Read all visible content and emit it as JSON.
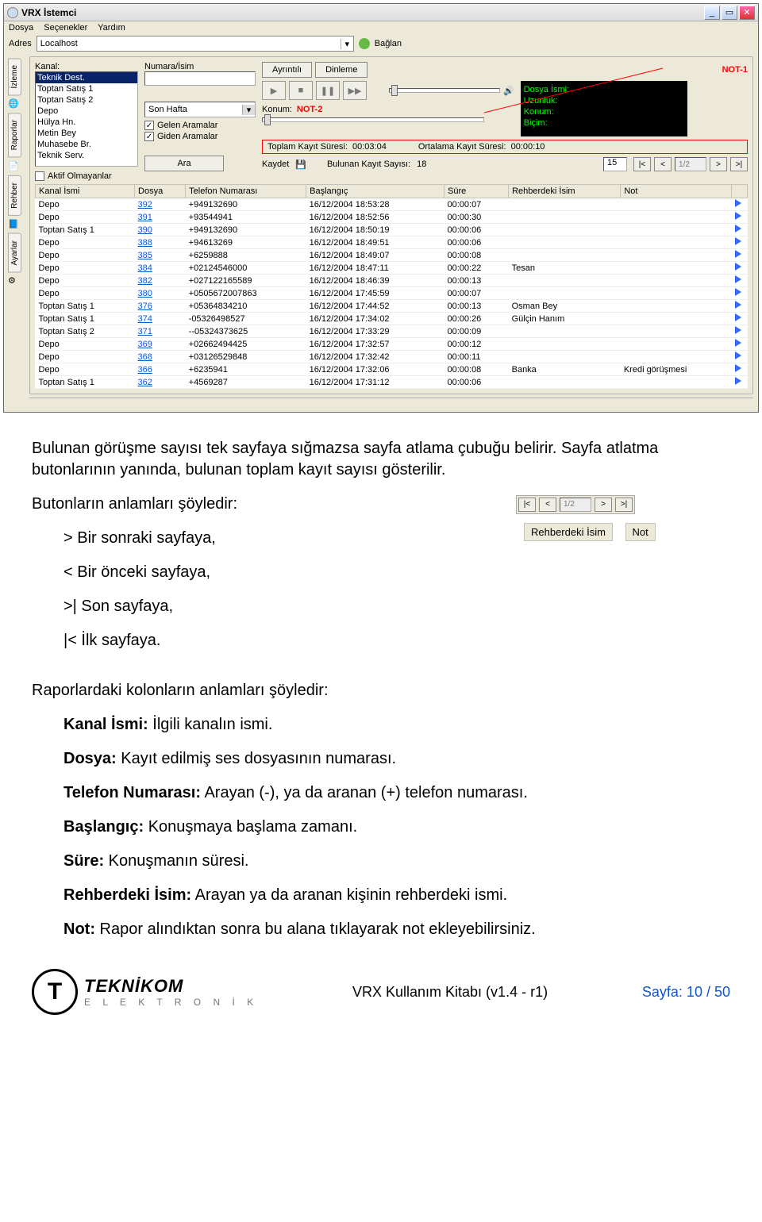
{
  "window": {
    "title": "VRX İstemci",
    "menu": {
      "file": "Dosya",
      "options": "Seçenekler",
      "help": "Yardım"
    },
    "address_label": "Adres",
    "address_value": "Localhost",
    "connect_label": "Bağlan"
  },
  "side_tabs": [
    "İzleme",
    "Raporlar",
    "Rehber",
    "Ayarlar"
  ],
  "filters": {
    "channel_label": "Kanal:",
    "channels": [
      "Teknik Dest.",
      "Toptan Satış 1",
      "Toptan Satış 2",
      "Depo",
      "Hülya Hn.",
      "Metin Bey",
      "Muhasebe Br.",
      "Teknik Serv."
    ],
    "name_label": "Numara/İsim",
    "period_label": "Son Hafta",
    "incoming_label": "Gelen Aramalar",
    "outgoing_label": "Giden Aramalar",
    "inactive_label": "Aktif Olmayanlar",
    "search_btn": "Ara"
  },
  "toolbar": {
    "detail_btn": "Ayrıntılı",
    "listen_btn": "Dinleme",
    "location_label": "Konum:",
    "note1": "NOT-1",
    "note2": "NOT-2",
    "file_info_labels": {
      "file": "Dosya İsmi:",
      "length": "Uzunluk:",
      "loc": "Konum:",
      "format": "Biçim:"
    },
    "total_label": "Toplam Kayıt Süresi:",
    "total_value": "00:03:04",
    "avg_label": "Ortalama Kayıt Süresi:",
    "avg_value": "00:00:10",
    "save_label": "Kaydet",
    "found_label": "Bulunan Kayıt Sayısı:",
    "found_value": "18",
    "page_size": "15",
    "page_indicator": "1/2"
  },
  "table": {
    "headers": [
      "Kanal İsmi",
      "Dosya",
      "Telefon Numarası",
      "Başlangıç",
      "Süre",
      "Rehberdeki İsim",
      "Not"
    ],
    "rows": [
      [
        "Depo",
        "392",
        "+949132690",
        "16/12/2004  18:53:28",
        "00:00:07",
        "",
        ""
      ],
      [
        "Depo",
        "391",
        "+93544941",
        "16/12/2004  18:52:56",
        "00:00:30",
        "",
        ""
      ],
      [
        "Toptan Satış 1",
        "390",
        "+949132690",
        "16/12/2004  18:50:19",
        "00:00:06",
        "",
        ""
      ],
      [
        "Depo",
        "388",
        "+94613269",
        "16/12/2004  18:49:51",
        "00:00:06",
        "",
        ""
      ],
      [
        "Depo",
        "385",
        "+6259888",
        "16/12/2004  18:49:07",
        "00:00:08",
        "",
        ""
      ],
      [
        "Depo",
        "384",
        "+02124546000",
        "16/12/2004  18:47:11",
        "00:00:22",
        "Tesan",
        ""
      ],
      [
        "Depo",
        "382",
        "+027122165589",
        "16/12/2004  18:46:39",
        "00:00:13",
        "",
        ""
      ],
      [
        "Depo",
        "380",
        "+0505672007863",
        "16/12/2004  17:45:59",
        "00:00:07",
        "",
        ""
      ],
      [
        "Toptan Satış 1",
        "376",
        "+05364834210",
        "16/12/2004  17:44:52",
        "00:00:13",
        "Osman Bey",
        ""
      ],
      [
        "Toptan Satış 1",
        "374",
        "-05326498527",
        "16/12/2004  17:34:02",
        "00:00:26",
        "Gülçin Hanım",
        ""
      ],
      [
        "Toptan Satış 2",
        "371",
        "--05324373625",
        "16/12/2004  17:33:29",
        "00:00:09",
        "",
        ""
      ],
      [
        "Depo",
        "369",
        "+02662494425",
        "16/12/2004  17:32:57",
        "00:00:12",
        "",
        ""
      ],
      [
        "Depo",
        "368",
        "+03126529848",
        "16/12/2004  17:32:42",
        "00:00:11",
        "",
        ""
      ],
      [
        "Depo",
        "366",
        "+6235941",
        "16/12/2004  17:32:06",
        "00:00:08",
        "Banka",
        "Kredi görüşmesi"
      ],
      [
        "Toptan Satış 1",
        "362",
        "+4569287",
        "16/12/2004  17:31:12",
        "00:00:06",
        "",
        ""
      ]
    ]
  },
  "doc": {
    "p1": "Bulunan görüşme sayısı tek sayfaya sığmazsa sayfa atlama çubuğu belirir. Sayfa atlatma butonlarının yanında, bulunan toplam kayıt sayısı gösterilir.",
    "p2": "Butonların anlamları şöyledir:",
    "b_next": ">    Bir sonraki sayfaya,",
    "b_prev": "<    Bir önceki sayfaya,",
    "b_last": ">|   Son sayfaya,",
    "b_first": "|<   İlk sayfaya.",
    "p3": "Raporlardaki kolonların anlamları şöyledir:",
    "c1_l": "Kanal İsmi:",
    "c1": " İlgili kanalın ismi.",
    "c2_l": "Dosya:",
    "c2": " Kayıt edilmiş ses dosyasının numarası.",
    "c3_l": "Telefon Numarası:",
    "c3": " Arayan (-), ya da aranan (+) telefon numarası.",
    "c4_l": "Başlangıç:",
    "c4": " Konuşmaya başlama zamanı.",
    "c5_l": "Süre:",
    "c5": " Konuşmanın süresi.",
    "c6_l": "Rehberdeki İsim:",
    "c6": " Arayan ya da aranan kişinin rehberdeki ismi.",
    "c7_l": "Not:",
    "c7": " Rapor alındıktan sonra bu alana tıklayarak not ekleyebilirsiniz.",
    "hdr_img1": "Rehberdeki İsim",
    "hdr_img2": "Not"
  },
  "footer": {
    "brand": "TEKNİKOM",
    "brand_sub": "E L E K T R O N İ K",
    "mid": "VRX Kullanım Kitabı (v1.4 - r1)",
    "page": "Sayfa: 10 / 50"
  }
}
